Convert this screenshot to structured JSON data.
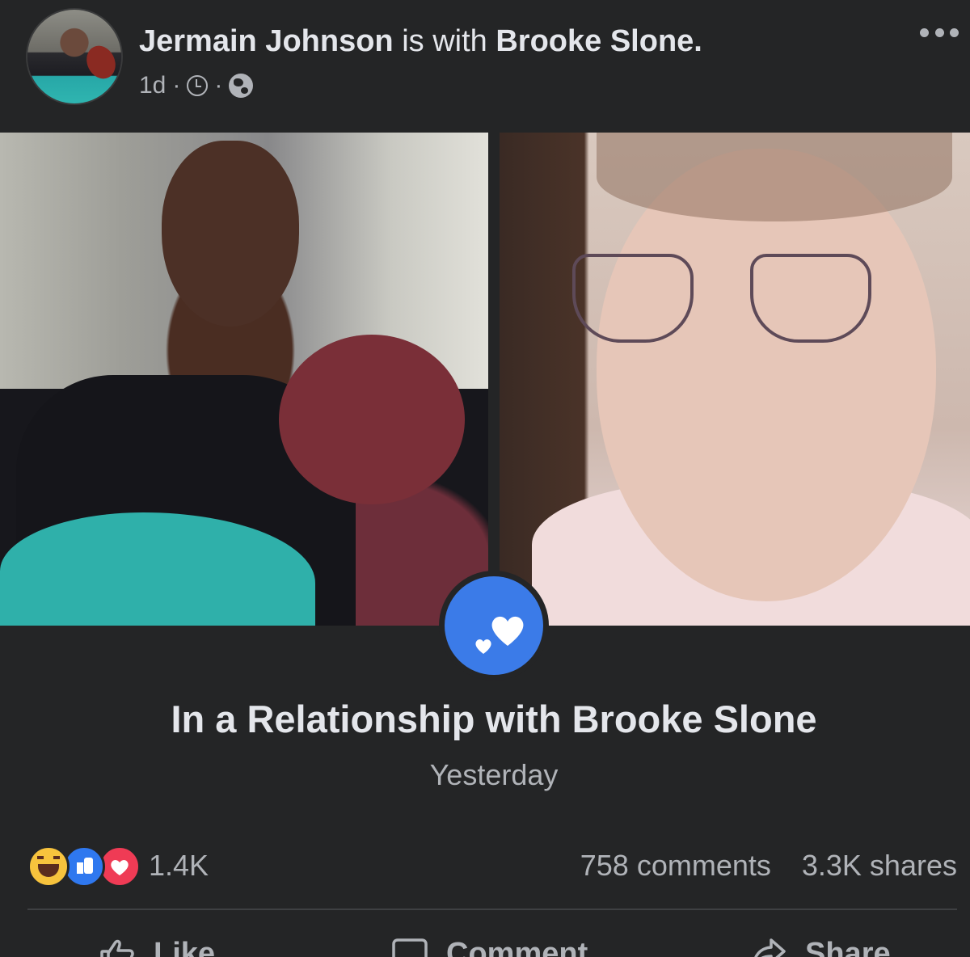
{
  "post": {
    "author": "Jermain Johnson",
    "with_text": "is with",
    "tagged": "Brooke Slone.",
    "time": "1d",
    "separator": "·"
  },
  "life_event": {
    "title": "In a Relationship with Brooke Slone",
    "date": "Yesterday"
  },
  "stats": {
    "reaction_count": "1.4K",
    "comments": "758 comments",
    "shares": "3.3K shares",
    "reaction_icons": [
      "haha-icon",
      "like-icon",
      "love-icon"
    ]
  },
  "actions": {
    "like": "Like",
    "comment": "Comment",
    "share": "Share"
  },
  "icons": {
    "more": "more-options-icon",
    "clock": "clock-icon",
    "privacy": "globe-icon",
    "relationship": "hearts-icon"
  },
  "colors": {
    "background": "#242526",
    "text_primary": "#e4e6eb",
    "text_secondary": "#b0b3b8",
    "relationship_badge": "#3b7be8",
    "like_blue": "#2f78ef",
    "love_red": "#ef3b55",
    "haha_yellow": "#f7c33d"
  }
}
